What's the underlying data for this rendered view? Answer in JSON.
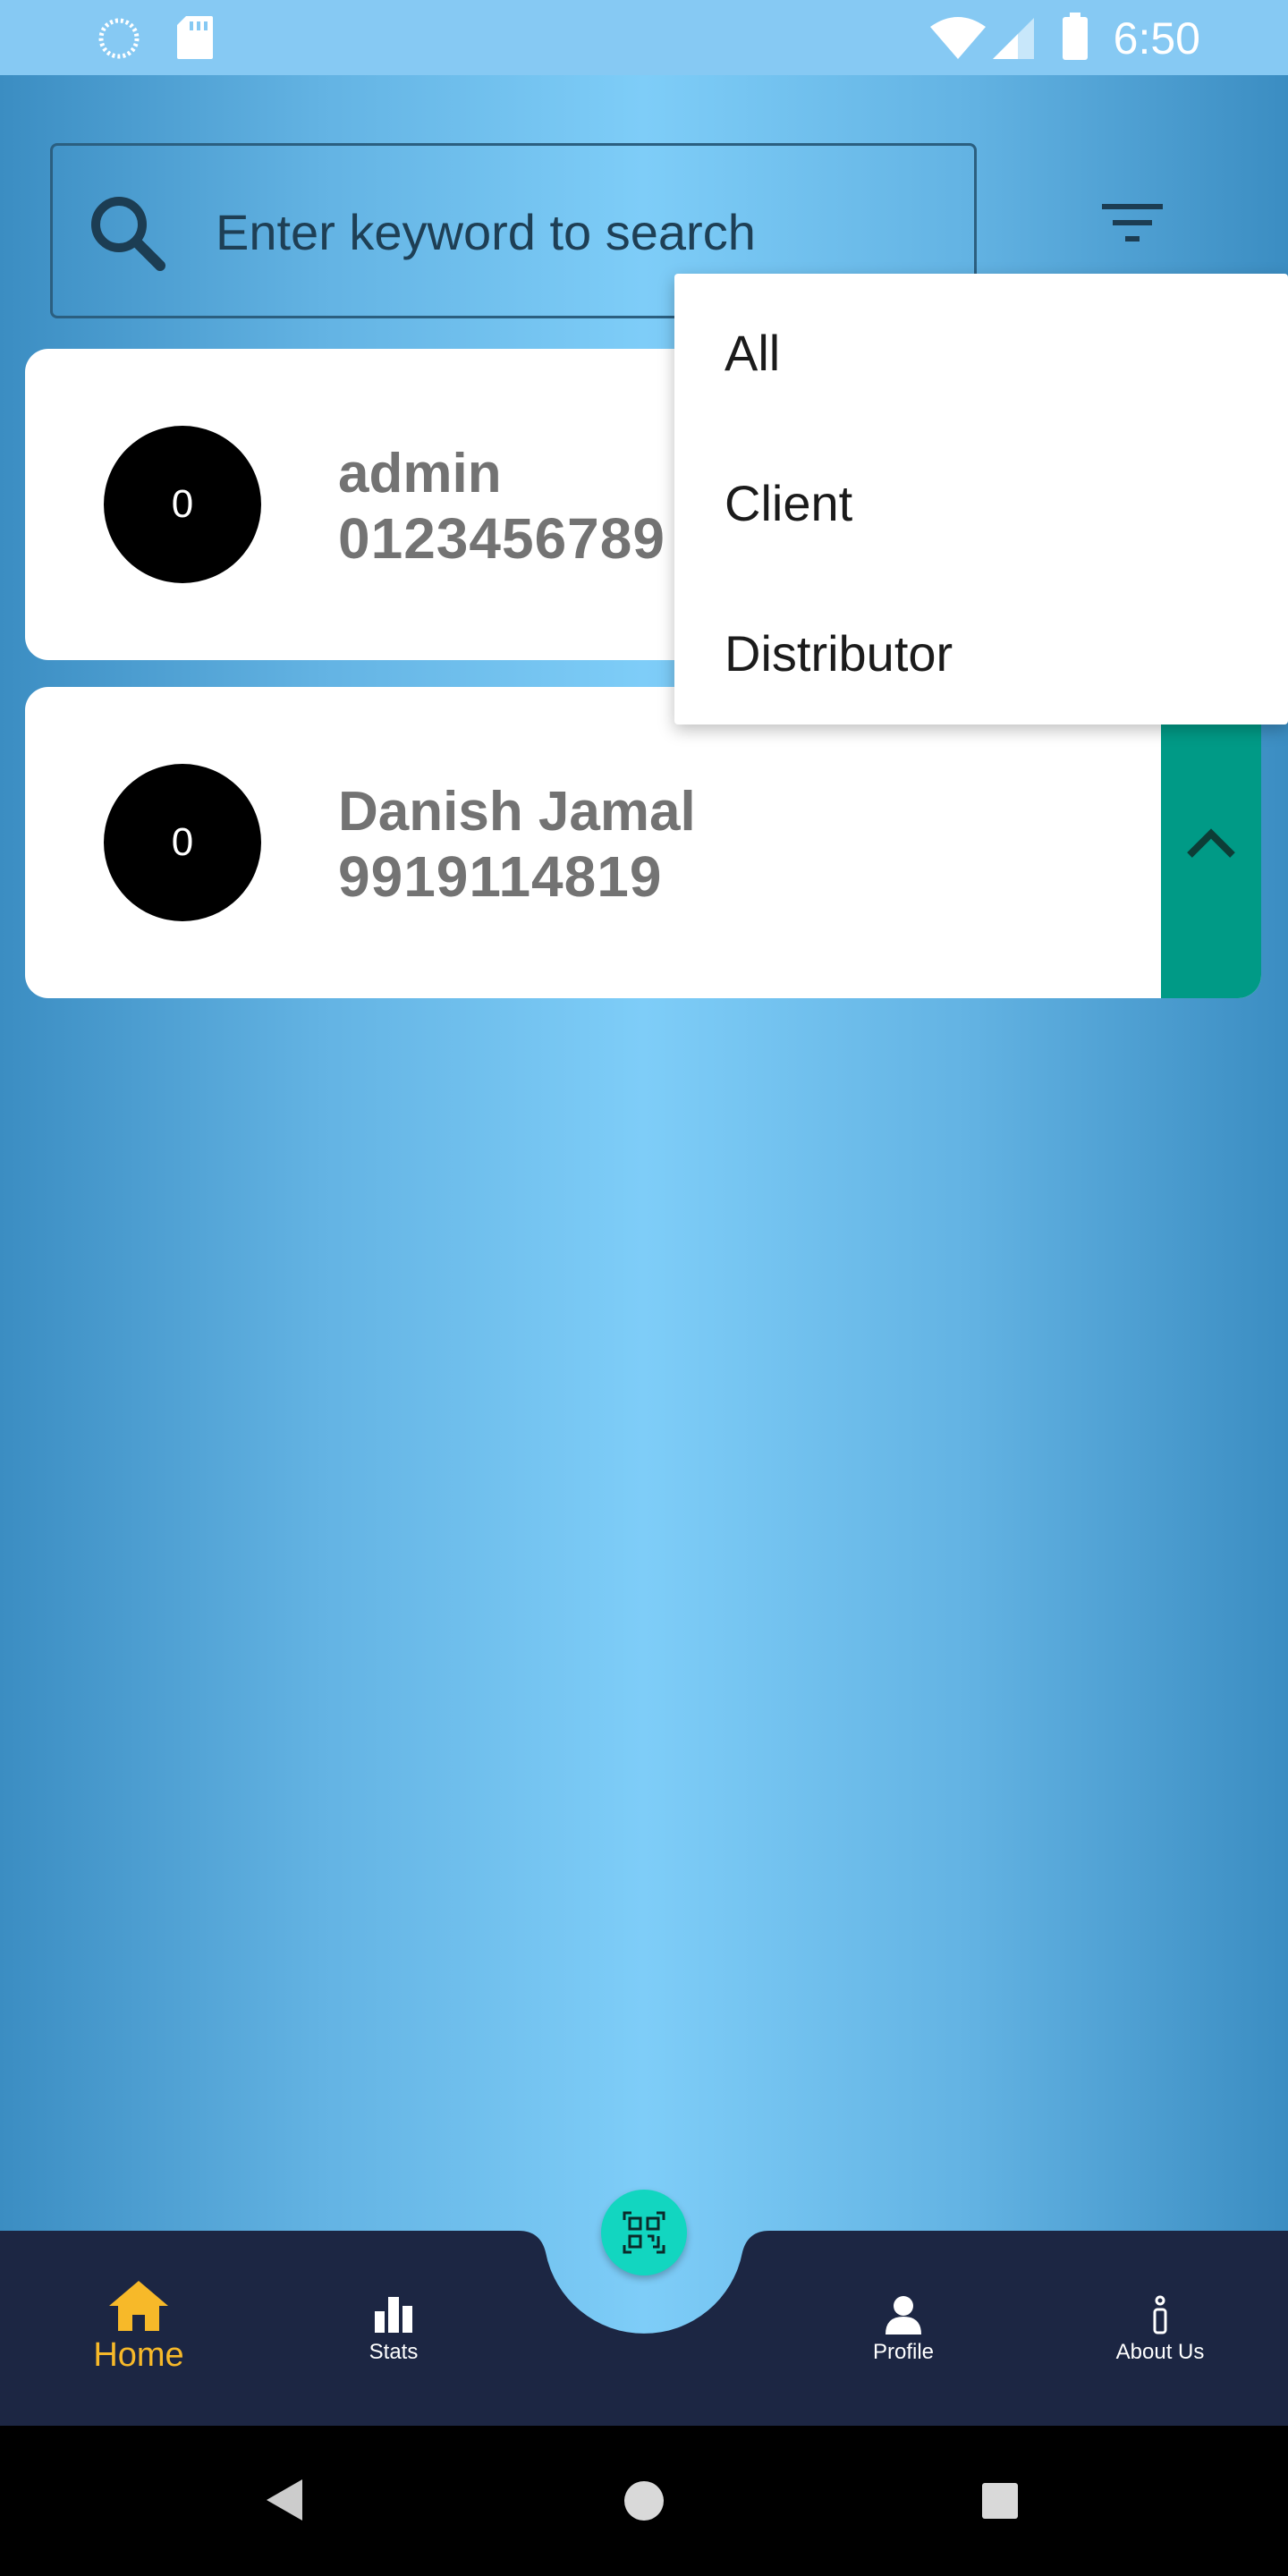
{
  "status_bar": {
    "time": "6:50",
    "icons": [
      "sync-icon",
      "sd-card-icon",
      "wifi-icon",
      "signal-icon",
      "battery-icon"
    ]
  },
  "search": {
    "placeholder": "Enter keyword to search",
    "value": ""
  },
  "filter_menu": {
    "items": [
      "All",
      "Client",
      "Distributor"
    ]
  },
  "contacts": [
    {
      "avatar_text": "0",
      "name": "admin",
      "phone": "0123456789"
    },
    {
      "avatar_text": "0",
      "name": "Danish Jamal",
      "phone": "9919114819"
    }
  ],
  "bottom_nav": {
    "items": [
      {
        "label": "Home",
        "icon": "home-icon",
        "active": true
      },
      {
        "label": "Stats",
        "icon": "bar-chart-icon",
        "active": false
      },
      {
        "label": "Profile",
        "icon": "user-icon",
        "active": false
      },
      {
        "label": "About Us",
        "icon": "info-icon",
        "active": false
      }
    ],
    "fab_icon": "qr-code-icon"
  },
  "colors": {
    "nav_bg": "#1c2643",
    "active": "#f7b929",
    "accent": "#009a86",
    "fab": "#12d6c0",
    "status_bar": "#86c9f3"
  }
}
